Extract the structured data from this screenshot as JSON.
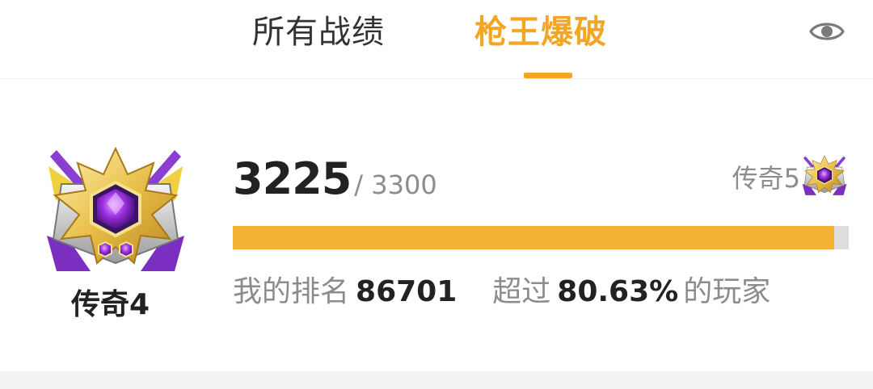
{
  "tabs": {
    "all_records": "所有战绩",
    "gun_king": "枪王爆破"
  },
  "rank": {
    "current_name": "传奇4",
    "score": "3225",
    "score_max": "/ 3300",
    "next_rank": "传奇5",
    "progress": 0.977
  },
  "stats": {
    "ranking_label": "我的排名",
    "ranking_value": "86701",
    "exceed_label": "超过",
    "exceed_value": "80.63%",
    "players_suffix": "的玩家"
  },
  "colors": {
    "accent": "#f2a623",
    "progress_fill": "#f4b232",
    "progress_track": "#dddddd",
    "gem": "#8a2be2"
  },
  "icons": {
    "visibility": "eye-icon",
    "current_badge": "legend-rank-badge",
    "next_badge": "legend-rank-badge"
  }
}
